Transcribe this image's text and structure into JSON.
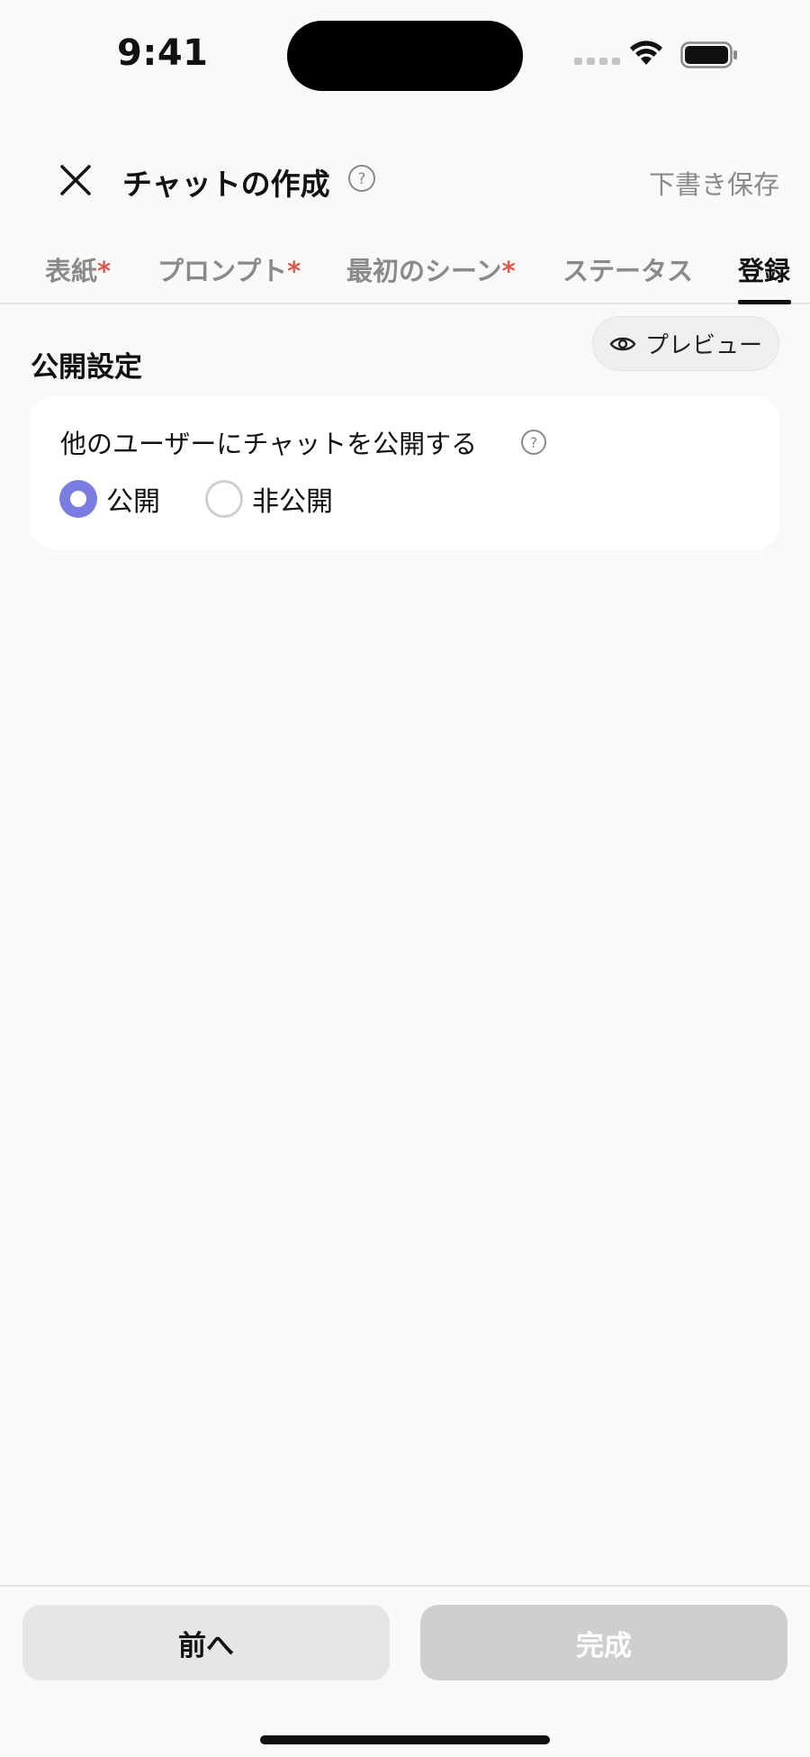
{
  "status_bar": {
    "time": "9:41"
  },
  "header": {
    "title": "チャットの作成",
    "draft_save": "下書き保存"
  },
  "tabs": [
    {
      "label": "表紙",
      "required": "*"
    },
    {
      "label": "プロンプト",
      "required": "*"
    },
    {
      "label": "最初のシーン",
      "required": "*"
    },
    {
      "label": "ステータス",
      "required": ""
    },
    {
      "label": "登録",
      "required": "",
      "active": true
    }
  ],
  "preview_button": {
    "label": "プレビュー"
  },
  "section": {
    "title": "公開設定",
    "card": {
      "label": "他のユーザーにチャットを公開する",
      "options": [
        {
          "label": "公開",
          "selected": true
        },
        {
          "label": "非公開",
          "selected": false
        }
      ]
    }
  },
  "footer": {
    "prev_label": "前へ",
    "done_label": "完成"
  },
  "colors": {
    "accent": "#7b7de0",
    "required": "#e2574c",
    "muted": "#8a8a8a"
  },
  "icons": [
    "close-icon",
    "help-icon",
    "eye-icon",
    "wifi-icon",
    "battery-icon",
    "signal-icon"
  ]
}
